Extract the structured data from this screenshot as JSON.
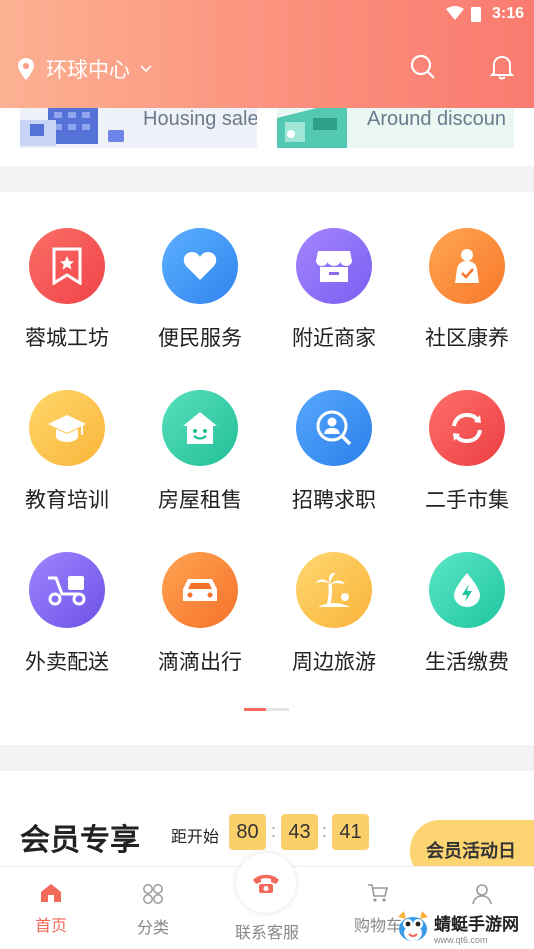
{
  "status_bar": {
    "time": "3:16"
  },
  "header": {
    "location": "环球中心"
  },
  "banners": [
    {
      "label": "Housing sale"
    },
    {
      "label": "Around discoun"
    }
  ],
  "categories": [
    {
      "label": "蓉城工坊",
      "icon": "bookmark-star-icon",
      "color": "#f35a55"
    },
    {
      "label": "便民服务",
      "icon": "heart-icon",
      "color": "#3d96f7"
    },
    {
      "label": "附近商家",
      "icon": "shop-icon",
      "color": "#8a6cf3"
    },
    {
      "label": "社区康养",
      "icon": "elderly-care-icon",
      "color": "#fb8e3c"
    },
    {
      "label": "教育培训",
      "icon": "graduation-cap-icon",
      "color": "#fbc149"
    },
    {
      "label": "房屋租售",
      "icon": "house-smile-icon",
      "color": "#33cfa7"
    },
    {
      "label": "招聘求职",
      "icon": "person-search-icon",
      "color": "#3a92ee"
    },
    {
      "label": "二手市集",
      "icon": "recycle-icon",
      "color": "#f35753"
    },
    {
      "label": "外卖配送",
      "icon": "delivery-scooter-icon",
      "color": "#8163ec"
    },
    {
      "label": "滴滴出行",
      "icon": "car-icon",
      "color": "#fb8638"
    },
    {
      "label": "周边旅游",
      "icon": "palm-tree-icon",
      "color": "#fbc54a"
    },
    {
      "label": "生活缴费",
      "icon": "water-drop-icon",
      "color": "#2fd5b1"
    }
  ],
  "member": {
    "title": "会员专享",
    "countdown_label": "距开始",
    "hours": "80",
    "minutes": "43",
    "seconds": "41",
    "activity_label": "会员活动日"
  },
  "tabbar": {
    "home": "首页",
    "category": "分类",
    "service": "联系客服",
    "cart": "购物车",
    "profile": ""
  },
  "watermark": {
    "name": "蜻蜓手游网",
    "url": "www.qt6.com"
  },
  "colors": {
    "accent": "#f26a5a",
    "header_start": "#fcb193",
    "header_end": "#fa7b6f"
  }
}
